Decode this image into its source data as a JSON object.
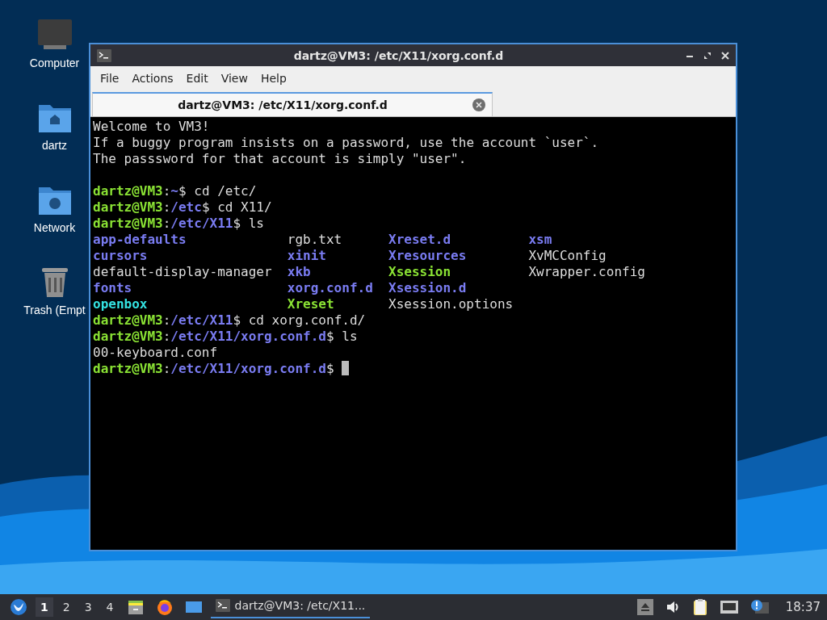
{
  "desktop_icons": [
    {
      "label": "Computer",
      "kind": "computer"
    },
    {
      "label": "dartz",
      "kind": "home"
    },
    {
      "label": "Network",
      "kind": "network"
    },
    {
      "label": "Trash (Empt",
      "kind": "trash"
    }
  ],
  "window": {
    "title": "dartz@VM3: /etc/X11/xorg.conf.d",
    "menu": [
      "File",
      "Actions",
      "Edit",
      "View",
      "Help"
    ],
    "tabs": [
      {
        "label": "dartz@VM3: /etc/X11/xorg.conf.d",
        "selected": true
      }
    ],
    "terminal": {
      "lines": [
        {
          "kind": "text",
          "text": "Welcome to VM3!"
        },
        {
          "kind": "text",
          "text": "If a buggy program insists on a password, use the account `user`."
        },
        {
          "kind": "text",
          "text": "The passsword for that account is simply \"user\"."
        },
        {
          "kind": "blank"
        },
        {
          "kind": "prompt",
          "user": "dartz@VM3",
          "sep": ":",
          "path": "~",
          "command": "$ cd /etc/"
        },
        {
          "kind": "prompt",
          "user": "dartz@VM3",
          "sep": ":",
          "path": "/etc",
          "command": "$ cd X11/"
        },
        {
          "kind": "prompt",
          "user": "dartz@VM3",
          "sep": ":",
          "path": "/etc/X11",
          "command": "$ ls"
        },
        {
          "kind": "listing",
          "rows": [
            [
              {
                "name": "app-defaults",
                "kind": "dir"
              },
              {
                "name": "rgb.txt",
                "kind": "file"
              },
              {
                "name": "Xreset.d",
                "kind": "dir"
              },
              {
                "name": "xsm",
                "kind": "dir"
              }
            ],
            [
              {
                "name": "cursors",
                "kind": "dir"
              },
              {
                "name": "xinit",
                "kind": "dir"
              },
              {
                "name": "Xresources",
                "kind": "dir"
              },
              {
                "name": "XvMCConfig",
                "kind": "file"
              }
            ],
            [
              {
                "name": "default-display-manager",
                "kind": "file"
              },
              {
                "name": "xkb",
                "kind": "dir"
              },
              {
                "name": "Xsession",
                "kind": "exec"
              },
              {
                "name": "Xwrapper.config",
                "kind": "file"
              }
            ],
            [
              {
                "name": "fonts",
                "kind": "dir"
              },
              {
                "name": "xorg.conf.d",
                "kind": "dir"
              },
              {
                "name": "Xsession.d",
                "kind": "dir"
              }
            ],
            [
              {
                "name": "openbox",
                "kind": "link"
              },
              {
                "name": "Xreset",
                "kind": "exec"
              },
              {
                "name": "Xsession.options",
                "kind": "file"
              }
            ]
          ]
        },
        {
          "kind": "prompt",
          "user": "dartz@VM3",
          "sep": ":",
          "path": "/etc/X11",
          "command": "$ cd xorg.conf.d/"
        },
        {
          "kind": "prompt",
          "user": "dartz@VM3",
          "sep": ":",
          "path": "/etc/X11/xorg.conf.d",
          "command": "$ ls"
        },
        {
          "kind": "text",
          "text": "00-keyboard.conf"
        },
        {
          "kind": "prompt",
          "user": "dartz@VM3",
          "sep": ":",
          "path": "/etc/X11/xorg.conf.d",
          "command": "$ ",
          "cursor": true
        }
      ]
    }
  },
  "taskbar": {
    "workspaces": [
      {
        "label": "1",
        "selected": true
      },
      {
        "label": "2",
        "selected": false
      },
      {
        "label": "3",
        "selected": false
      },
      {
        "label": "4",
        "selected": false
      }
    ],
    "tasks": [
      {
        "label": "dartz@VM3: /etc/X11...",
        "selected": true
      }
    ],
    "clock": "18:37"
  }
}
